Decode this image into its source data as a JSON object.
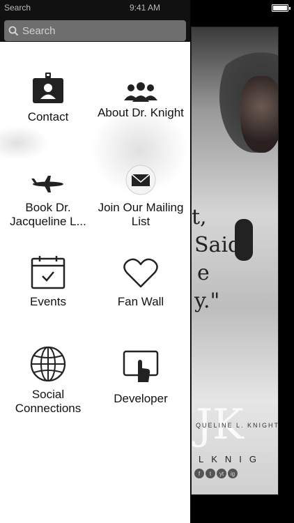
{
  "status_bar": {
    "carrier": "Search",
    "time": "9:41 AM"
  },
  "search": {
    "placeholder": "Search"
  },
  "menu_items": [
    {
      "label": "Contact",
      "icon": "id-badge-icon"
    },
    {
      "label": "About Dr. Knight",
      "icon": "group-icon"
    },
    {
      "label": "Book Dr. Jacqueline L...",
      "icon": "airplane-icon"
    },
    {
      "label": "Join Our Mailing List",
      "icon": "envelope-icon"
    },
    {
      "label": "Events",
      "icon": "calendar-check-icon"
    },
    {
      "label": "Fan Wall",
      "icon": "heart-icon"
    },
    {
      "label": "Social Connections",
      "icon": "globe-icon"
    },
    {
      "label": "Developer",
      "icon": "tablet-tap-icon"
    }
  ],
  "poster": {
    "quote_lines": [
      "t,",
      "Said,",
      "e",
      "y.\""
    ],
    "logo": "JK",
    "name": "QUELINE L. KNIGHT",
    "brand": "LKNIG",
    "social_icons": [
      "f",
      "t",
      "yt",
      "ig"
    ]
  },
  "colors": {
    "menu_background": "#ffffff",
    "search_background": "#6e6e6e",
    "top_bar": "#111111"
  }
}
